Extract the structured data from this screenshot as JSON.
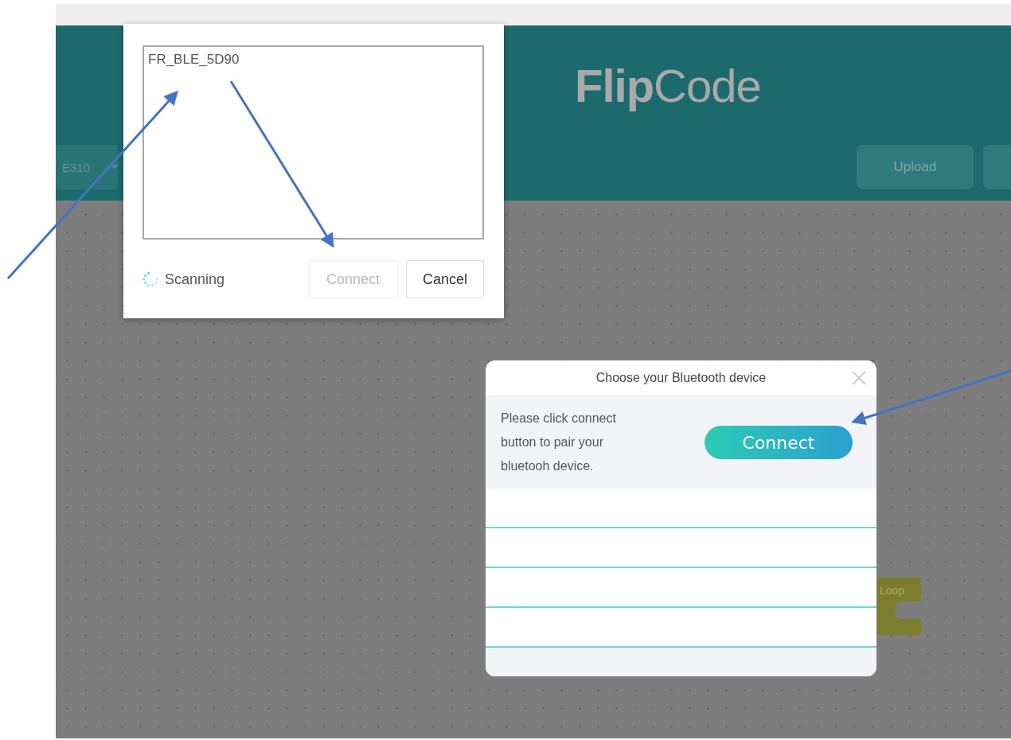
{
  "app": {
    "logo": "**Flip**Code",
    "board_select": {
      "value": "E310"
    },
    "toolbar_buttons": [
      {
        "kind": "labeled",
        "label": "Upload"
      },
      {
        "kind": "blank"
      }
    ],
    "canvas_blocks": [
      {
        "label": "Loop"
      }
    ]
  },
  "device_chooser": {
    "devices": [
      {
        "name": "FR_BLE_5D90",
        "selected": false
      }
    ],
    "status": "Scanning",
    "scanning": true,
    "buttons": [
      {
        "label": "Connect",
        "disabled": true
      },
      {
        "label": "Cancel",
        "disabled": false
      }
    ]
  },
  "bluetooth_modal": {
    "title": "Choose your Bluetooth device",
    "message": "Please click connect button to pair your bluetooh device.",
    "connect_button": "Connect"
  }
}
